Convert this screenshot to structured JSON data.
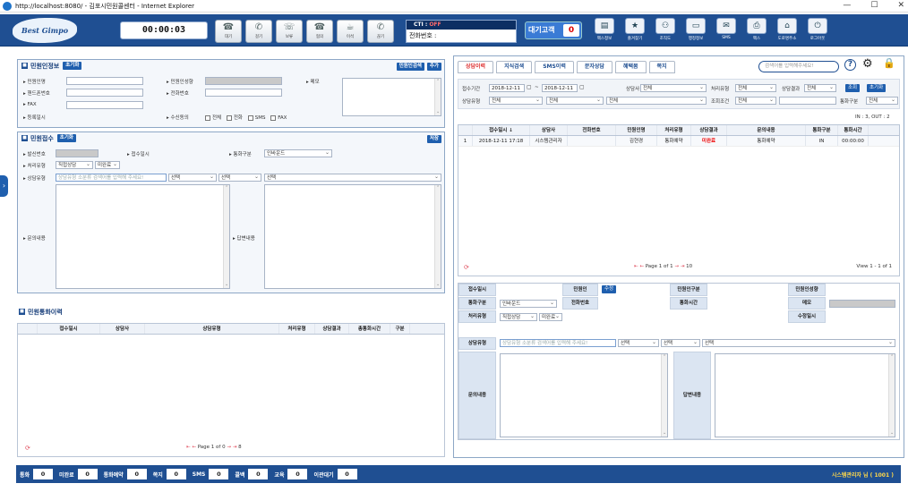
{
  "window": {
    "title": "http://localhost:8080/ - 김포시민원콜센터 - Internet Explorer",
    "btn_min": "—",
    "btn_max": "☐",
    "btn_close": "✕"
  },
  "logo": {
    "text": "Best Gimpo"
  },
  "timer": "00:00:03",
  "call_buttons": [
    {
      "label": "대기",
      "icon": "☎"
    },
    {
      "label": "걸기",
      "icon": "✆"
    },
    {
      "label": "보류",
      "icon": "☏"
    },
    {
      "label": "협의",
      "icon": "☎"
    },
    {
      "label": "이석",
      "icon": "☕"
    },
    {
      "label": "끊기",
      "icon": "✆"
    }
  ],
  "cti": {
    "label": "CTI : ",
    "status": "OFF",
    "phone_label": "전화번호 :"
  },
  "waiting": {
    "label": "대기고객",
    "count": "0"
  },
  "toolbar": [
    {
      "label": "팩스정보",
      "icon": "▤"
    },
    {
      "label": "즐겨찾기",
      "icon": "★"
    },
    {
      "label": "조직도",
      "icon": "⚇"
    },
    {
      "label": "행정정보",
      "icon": "▭"
    },
    {
      "label": "SMS",
      "icon": "✉"
    },
    {
      "label": "팩스",
      "icon": "⎙"
    },
    {
      "label": "도로명주소",
      "icon": "⌂"
    },
    {
      "label": "로그아웃",
      "icon": "⏻"
    }
  ],
  "sidehandle": "›",
  "civil_info": {
    "title": "민원인정보",
    "reset": "초기화",
    "search_btn": "민원인검색",
    "add_btn": "추가",
    "name": "민원인명",
    "status": "민원인성향",
    "memo": "메모",
    "mobile": "핸드폰번호",
    "phone": "전화번호",
    "fax": "FAX",
    "reg_date": "등록일시",
    "consent": "수신동의",
    "consent_opts": [
      "전체",
      "전화",
      "SMS",
      "FAX"
    ]
  },
  "civil_recv": {
    "title": "민원접수",
    "reset": "초기화",
    "save": "저장",
    "send_no": "발신번호",
    "recv_date": "접수일시",
    "call_type": "통화구분",
    "call_type_val": "인바운드",
    "proc_type": "처리유형",
    "proc_val1": "직접상담",
    "proc_val2": "미완료",
    "consult_type": "상담유형",
    "consult_placeholder": "상담유형 소분류 검색어를 입력해 주세요!",
    "sel1": "선택",
    "sel2": "선택",
    "sel3": "선택",
    "inquiry": "문의내용",
    "answer": "답변내용"
  },
  "call_history": {
    "title": "민원통화이력",
    "headers": [
      "접수일시",
      "상담사",
      "상담유형",
      "처리유형",
      "상담결과",
      "총통화시간",
      "구분"
    ],
    "pager": {
      "prev": "⇤ ←",
      "page_label": "Page",
      "page": "1",
      "of_label": "of",
      "total": "0",
      "next": "→ ⇥",
      "size": "8"
    }
  },
  "tabs": [
    "상담이력",
    "지식검색",
    "SMS이력",
    "문자상담",
    "혜택봄",
    "쪽지"
  ],
  "search": {
    "placeholder": "검색어를 입력해주세요!",
    "help": "?",
    "gear": "⚙",
    "lock": "🔒"
  },
  "filters": {
    "recv_period": "접수기간",
    "date_from": "2018-12-11",
    "tilde": "~",
    "date_to": "2018-12-11",
    "agent": "상담사",
    "agent_val": "전체",
    "proc_type": "처리유형",
    "proc_val": "전체",
    "result": "상담결과",
    "result_val": "전체",
    "search_btn": "조회",
    "reset_btn": "초기화",
    "consult_type": "상담유형",
    "ct1": "전체",
    "ct2": "전체",
    "ct3": "전체",
    "cond": "조회조건",
    "cond_val": "전체",
    "call_type": "통화구분",
    "call_type_val": "전체"
  },
  "counts": "IN : 3, OUT : 2",
  "history_grid": {
    "headers": [
      "",
      "접수일시 ↓",
      "상담사",
      "전화번호",
      "민원인명",
      "처리유형",
      "상담결과",
      "문의내용",
      "통화구분",
      "통화시간"
    ],
    "rows": [
      [
        "1",
        "2018-12-11 17:18",
        "시스템관리자",
        "",
        "김현경",
        "통화예약",
        "미완료",
        "통화예약",
        "IN",
        "00:00:00"
      ]
    ],
    "pager": {
      "prev": "⇤ ←",
      "page_label": "Page",
      "page": "1",
      "of_label": "of",
      "total": "1",
      "next": "→ ⇥",
      "size": "10",
      "view": "View 1 - 1 of 1"
    }
  },
  "detail": {
    "recv_date": "접수일시",
    "civil": "민원인",
    "edit": "수정",
    "civil_type": "민원인구분",
    "civil_status": "민원인성향",
    "call_type": "통화구분",
    "call_type_val": "인바운드",
    "phone": "전화번호",
    "call_time": "통화시간",
    "memo": "메모",
    "proc_type": "처리유형",
    "proc_val1": "직접상담",
    "proc_val2": "미완료",
    "mod_date": "수정일시",
    "consult_type": "상담유형",
    "consult_placeholder": "상담유형 소분류 검색어를 입력해 주세요!",
    "sel1": "선택",
    "sel2": "선택",
    "sel3": "선택",
    "inquiry": "문의내용",
    "answer": "답변내용"
  },
  "bottom": {
    "stats": [
      {
        "label": "통화",
        "value": "0"
      },
      {
        "label": "미완료",
        "value": "0"
      },
      {
        "label": "통화예약",
        "value": "0"
      },
      {
        "label": "쪽지",
        "value": "0"
      },
      {
        "label": "SMS",
        "value": "0"
      },
      {
        "label": "콜백",
        "value": "0"
      },
      {
        "label": "교육",
        "value": "0"
      },
      {
        "label": "이관대기",
        "value": "0"
      }
    ],
    "user": "시스템관리자 님 ( 1001 )"
  }
}
